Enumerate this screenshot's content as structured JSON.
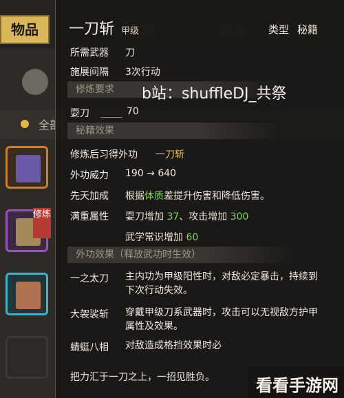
{
  "background": {
    "tab_active": "物品",
    "tab_faded": "武器",
    "tab_martial": "武道",
    "filter_all": "全部",
    "slot_tag": "修炼"
  },
  "tooltip": {
    "title": "一刀斩",
    "title_tag": "甲级",
    "header_right": {
      "type_label": "类型",
      "type_value": "秘籍"
    },
    "rows": {
      "weapon_label": "所需武器",
      "weapon_value": "刀",
      "interval_label": "施展间隔",
      "interval_value": "3次行动",
      "req_section": "修炼要求",
      "sword_label": "耍刀",
      "sword_value": "70",
      "effect_section": "秘籍效果",
      "learn_label": "修炼后习得外功",
      "learn_value": "一刀斩",
      "power_label": "外功威力",
      "power_value": "190 → 640",
      "innate_label": "先天加成",
      "innate_pre": "根据",
      "innate_attr": "体质",
      "innate_post": "差提升伤害和降低伤害。",
      "full_label": "满重属性",
      "full_1": "耍刀增加",
      "full_1_val": "37",
      "full_2": "、攻击增加",
      "full_2_val": "300",
      "full_3": "武学常识增加",
      "full_3_val": "60",
      "release_section": "外功效果（释放武功时生效）",
      "skill1_label": "一之太刀",
      "skill1_line1": "主内功为甲级阳性时，对敌必定暴击，持续到",
      "skill1_line2": "下次行动失效。",
      "skill2_label": "大袈裟斩",
      "skill2_line1": "穿戴甲级刀系武器时，攻击可以无视敌方护甲",
      "skill2_line2": "属性及效果。",
      "skill3_label": "蜻蜓八相",
      "skill3_line1": "对敌造成格挡效果时必",
      "bottom_line": "把力汇于一刀之上，一招见胜负。"
    }
  },
  "watermark": "b站：shuffleDJ_共祭",
  "brand": "看看手游网",
  "colors": {
    "gold": "#e8c45a",
    "green": "#7ed957",
    "panel": "#1a1816"
  }
}
